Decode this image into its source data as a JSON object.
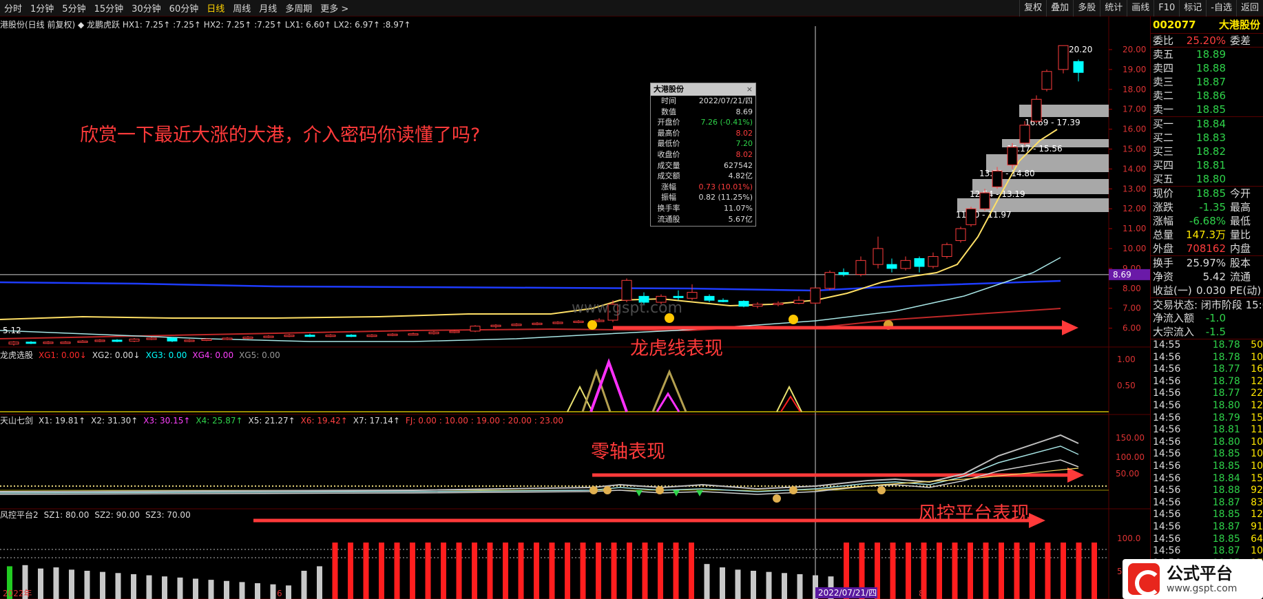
{
  "toolbar": {
    "periods": [
      "分时",
      "1分钟",
      "5分钟",
      "15分钟",
      "30分钟",
      "60分钟",
      "日线",
      "周线",
      "月线",
      "多周期",
      "更多 >"
    ],
    "active_period": "日线",
    "right_tools": [
      "复权",
      "叠加",
      "多股",
      "统计",
      "画线",
      "F10",
      "标记",
      "-自选",
      "返回"
    ]
  },
  "main_panel": {
    "header": "港股份(日线 前复权)  ◆ 龙鹏虎跃  HX1: 7.25↑  :7.25↑  HX2: 7.25↑  :7.25↑  LX1: 6.60↑  LX2: 6.97↑  :8.97↑",
    "price_axis": [
      "20.00",
      "19.00",
      "18.00",
      "17.00",
      "16.00",
      "15.00",
      "14.00",
      "13.00",
      "12.00",
      "11.00",
      "10.00",
      "9.00",
      "8.00",
      "7.00",
      "6.00"
    ],
    "crosshair_price": "8.69",
    "high_label": "20.20",
    "low_label": "5.12",
    "platform_labels": [
      "16.69 - 17.39",
      "15.17 - 15.56",
      "13.79 - 14.80",
      "12.54 - 13.19",
      "11.40 - 11.97"
    ],
    "watermark": "www.gspt.com"
  },
  "tooltip": {
    "title": "大港股份",
    "close_icon": "×",
    "rows": [
      {
        "k": "时间",
        "v": "2022/07/21/四",
        "c": "white"
      },
      {
        "k": "数值",
        "v": "8.69",
        "c": "white"
      },
      {
        "k": "开盘价",
        "v": "7.26 (-0.41%)",
        "c": "green"
      },
      {
        "k": "最高价",
        "v": "8.02",
        "c": "red"
      },
      {
        "k": "最低价",
        "v": "7.20",
        "c": "green"
      },
      {
        "k": "收盘价",
        "v": "8.02",
        "c": "red"
      },
      {
        "k": "成交量",
        "v": "627542",
        "c": "white"
      },
      {
        "k": "成交额",
        "v": "4.82亿",
        "c": "white"
      },
      {
        "k": "涨幅",
        "v": "0.73 (10.01%)",
        "c": "red"
      },
      {
        "k": "振幅",
        "v": "0.82 (11.25%)",
        "c": "white"
      },
      {
        "k": "换手率",
        "v": "11.07%",
        "c": "white"
      },
      {
        "k": "流通股",
        "v": "5.67亿",
        "c": "white"
      }
    ]
  },
  "annotations": {
    "headline": "欣赏一下最近大涨的大港，介入密码你读懂了吗?",
    "longhu": "龙虎线表现",
    "zero_axis": "零轴表现",
    "risk": "风控平台表现"
  },
  "ind1": {
    "label": "龙虎选股",
    "items": [
      {
        "t": "XG1: 0.00↓",
        "c": "#ff2a2a"
      },
      {
        "t": "XG2: 0.00↓",
        "c": "#ddd"
      },
      {
        "t": "XG3: 0.00",
        "c": "#00ffff"
      },
      {
        "t": "XG4: 0.00",
        "c": "#ff40ff"
      },
      {
        "t": "XG5: 0.00",
        "c": "#999"
      }
    ],
    "axis": [
      "1.00",
      "0.50"
    ]
  },
  "ind2": {
    "label": "天山七剑",
    "items": [
      {
        "t": "X1: 19.81↑",
        "c": "#ddd"
      },
      {
        "t": "X2: 31.30↑",
        "c": "#ddd"
      },
      {
        "t": "X3: 30.15↑",
        "c": "#ff40ff"
      },
      {
        "t": "X4: 25.87↑",
        "c": "#2fd44a"
      },
      {
        "t": "X5: 21.27↑",
        "c": "#ddd"
      },
      {
        "t": "X6: 19.42↑",
        "c": "#ff4040"
      },
      {
        "t": "X7: 17.14↑",
        "c": "#ddd"
      },
      {
        "t": "FJ: 0.00 : 10.00 : 19.00 : 20.00 : 23.00",
        "c": "#ff4040"
      }
    ],
    "axis": [
      "150.00",
      "100.00",
      "50.00"
    ]
  },
  "ind3": {
    "label": "风控平台2",
    "items": [
      {
        "t": "SZ1: 80.00",
        "c": "#ddd"
      },
      {
        "t": "SZ2: 90.00",
        "c": "#ddd"
      },
      {
        "t": "SZ3: 70.00",
        "c": "#ddd"
      }
    ],
    "axis": [
      "100.0",
      "50.0"
    ]
  },
  "date_axis": [
    "2022年",
    "6",
    "7",
    "8"
  ],
  "date_highlight": "2022/07/21/四",
  "side": {
    "code": "002077",
    "name": "大港股份",
    "weibi": {
      "k": "委比",
      "v": "25.20%",
      "k2": "委差"
    },
    "asks": [
      {
        "k": "卖五",
        "v": "18.89"
      },
      {
        "k": "卖四",
        "v": "18.88"
      },
      {
        "k": "卖三",
        "v": "18.87"
      },
      {
        "k": "卖二",
        "v": "18.86"
      },
      {
        "k": "卖一",
        "v": "18.85"
      }
    ],
    "bids": [
      {
        "k": "买一",
        "v": "18.84"
      },
      {
        "k": "买二",
        "v": "18.83"
      },
      {
        "k": "买三",
        "v": "18.82"
      },
      {
        "k": "买四",
        "v": "18.81"
      },
      {
        "k": "买五",
        "v": "18.80"
      }
    ],
    "quote": [
      {
        "k": "现价",
        "v": "18.85",
        "c": "green",
        "k2": "今开"
      },
      {
        "k": "涨跌",
        "v": "-1.35",
        "c": "green",
        "k2": "最高"
      },
      {
        "k": "涨幅",
        "v": "-6.68%",
        "c": "green",
        "k2": "最低"
      },
      {
        "k": "总量",
        "v": "147.3万",
        "c": "yellow",
        "k2": "量比"
      },
      {
        "k": "外盘",
        "v": "708162",
        "c": "red",
        "k2": "内盘"
      }
    ],
    "quote2": [
      {
        "k": "换手",
        "v": "25.97%",
        "c": "white",
        "k2": "股本"
      },
      {
        "k": "净资",
        "v": "5.42",
        "c": "white",
        "k2": "流通"
      },
      {
        "k": "收益(一)",
        "v": "0.030",
        "c": "white",
        "k2": "PE(动)"
      }
    ],
    "status": "交易状态: 闭市阶段 15:0",
    "flows": [
      {
        "k": "净流入额",
        "v": "-1.0",
        "c": "green"
      },
      {
        "k": "大宗流入",
        "v": "-1.5",
        "c": "green"
      }
    ],
    "ticks": [
      {
        "t": "14:55",
        "p": "18.78",
        "v": "50"
      },
      {
        "t": "14:56",
        "p": "18.78",
        "v": "10"
      },
      {
        "t": "14:56",
        "p": "18.77",
        "v": "16"
      },
      {
        "t": "14:56",
        "p": "18.78",
        "v": "12"
      },
      {
        "t": "14:56",
        "p": "18.77",
        "v": "22"
      },
      {
        "t": "14:56",
        "p": "18.80",
        "v": "12"
      },
      {
        "t": "14:56",
        "p": "18.79",
        "v": "15"
      },
      {
        "t": "14:56",
        "p": "18.81",
        "v": "11"
      },
      {
        "t": "14:56",
        "p": "18.80",
        "v": "10"
      },
      {
        "t": "14:56",
        "p": "18.85",
        "v": "10"
      },
      {
        "t": "14:56",
        "p": "18.85",
        "v": "10"
      },
      {
        "t": "14:56",
        "p": "18.84",
        "v": "15"
      },
      {
        "t": "14:56",
        "p": "18.88",
        "v": "92"
      },
      {
        "t": "14:56",
        "p": "18.87",
        "v": "83"
      },
      {
        "t": "14:56",
        "p": "18.85",
        "v": "12"
      },
      {
        "t": "14:56",
        "p": "18.87",
        "v": "91"
      },
      {
        "t": "14:56",
        "p": "18.85",
        "v": "64"
      },
      {
        "t": "14:56",
        "p": "18.87",
        "v": "10"
      },
      {
        "t": "14:56",
        "p": "18.85",
        "v": "17"
      }
    ]
  },
  "logo": {
    "title": "公式平台",
    "url": "www.gspt.com"
  },
  "colors": {
    "up": "#ff3d3d",
    "down": "#00ffff",
    "ma_short": "#ffe066",
    "ma_long": "#1e3cff",
    "ma_mid": "#a8e6e6",
    "grid": "#5a0000"
  }
}
